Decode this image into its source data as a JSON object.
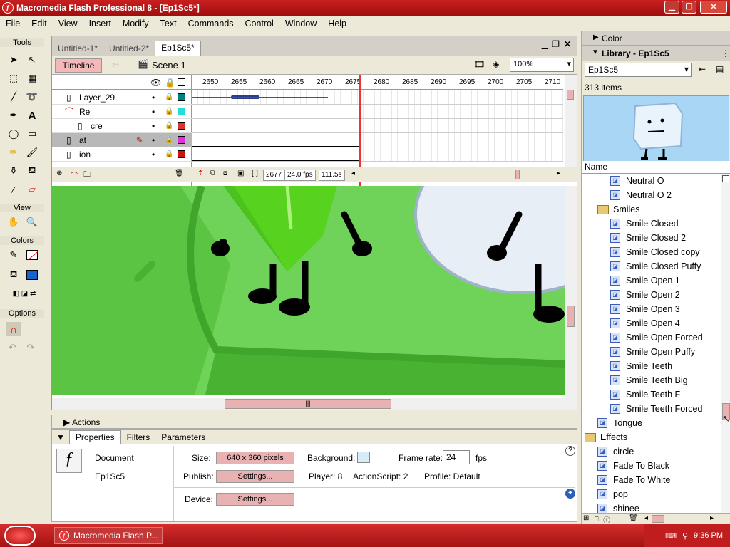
{
  "window": {
    "title": "Macromedia Flash Professional 8 - [Ep1Sc5*]"
  },
  "menu": [
    "File",
    "Edit",
    "View",
    "Insert",
    "Modify",
    "Text",
    "Commands",
    "Control",
    "Window",
    "Help"
  ],
  "tools": {
    "title": "Tools",
    "view": "View",
    "colors": "Colors",
    "options": "Options"
  },
  "doc_tabs": [
    "Untitled-1*",
    "Untitled-2*",
    "Ep1Sc5*"
  ],
  "timeline_bar": {
    "timeline": "Timeline",
    "scene": "Scene 1",
    "zoom": "100%"
  },
  "layers": [
    {
      "name": "Layer_29",
      "color": "#008080"
    },
    {
      "name": "Re",
      "color": "#22dddd"
    },
    {
      "name": "cre",
      "color": "#dd3333"
    },
    {
      "name": "at",
      "color": "#dd33dd"
    },
    {
      "name": "ion",
      "color": "#cc1111"
    }
  ],
  "ruler": [
    "2650",
    "2655",
    "2660",
    "2665",
    "2670",
    "2675",
    "2680",
    "2685",
    "2690",
    "2695",
    "2700",
    "2705",
    "2710"
  ],
  "timeline_status": {
    "frame": "2677",
    "fps": "24.0 fps",
    "time": "111.5s"
  },
  "actions_label": "Actions",
  "prop_tabs": [
    "Properties",
    "Filters",
    "Parameters"
  ],
  "properties": {
    "doc_label": "Document",
    "doc_name": "Ep1Sc5",
    "size_label": "Size:",
    "size_value": "640 x 360 pixels",
    "background_label": "Background:",
    "framerate_label": "Frame rate:",
    "framerate_value": "24",
    "fps": "fps",
    "publish_label": "Publish:",
    "settings": "Settings...",
    "player": "Player: 8",
    "actionscript": "ActionScript: 2",
    "profile": "Profile: Default",
    "device_label": "Device:"
  },
  "right_panel": {
    "color": "Color",
    "library": "Library - Ep1Sc5",
    "library_select": "Ep1Sc5",
    "item_count": "313 items",
    "name_header": "Name"
  },
  "library_items": [
    {
      "label": "Neutral O",
      "type": "symbol",
      "indent": 2
    },
    {
      "label": "Neutral O 2",
      "type": "symbol",
      "indent": 2
    },
    {
      "label": "Smiles",
      "type": "folder",
      "indent": 1
    },
    {
      "label": "Smile Closed",
      "type": "symbol",
      "indent": 2
    },
    {
      "label": "Smile Closed 2",
      "type": "symbol",
      "indent": 2
    },
    {
      "label": "Smile Closed copy",
      "type": "symbol",
      "indent": 2
    },
    {
      "label": "Smile Closed Puffy",
      "type": "symbol",
      "indent": 2
    },
    {
      "label": "Smile Open 1",
      "type": "symbol",
      "indent": 2
    },
    {
      "label": "Smile Open 2",
      "type": "symbol",
      "indent": 2
    },
    {
      "label": "Smile Open 3",
      "type": "symbol",
      "indent": 2
    },
    {
      "label": "Smile Open 4",
      "type": "symbol",
      "indent": 2
    },
    {
      "label": "Smile Open Forced",
      "type": "symbol",
      "indent": 2
    },
    {
      "label": "Smile Open Puffy",
      "type": "symbol",
      "indent": 2
    },
    {
      "label": "Smile Teeth",
      "type": "symbol",
      "indent": 2
    },
    {
      "label": "Smile Teeth Big",
      "type": "symbol",
      "indent": 2
    },
    {
      "label": "Smile Teeth F",
      "type": "symbol",
      "indent": 2
    },
    {
      "label": "Smile Teeth Forced",
      "type": "symbol",
      "indent": 2
    },
    {
      "label": "Tongue",
      "type": "symbol",
      "indent": 1
    },
    {
      "label": "Effects",
      "type": "folder",
      "indent": 0
    },
    {
      "label": "circle",
      "type": "symbol",
      "indent": 1
    },
    {
      "label": "Fade To Black",
      "type": "symbol",
      "indent": 1
    },
    {
      "label": "Fade To White",
      "type": "symbol",
      "indent": 1
    },
    {
      "label": "pop",
      "type": "symbol",
      "indent": 1
    },
    {
      "label": "shinee",
      "type": "symbol",
      "indent": 1
    }
  ],
  "taskbar": {
    "item": "Macromedia Flash P...",
    "clock": "9:36 PM"
  }
}
